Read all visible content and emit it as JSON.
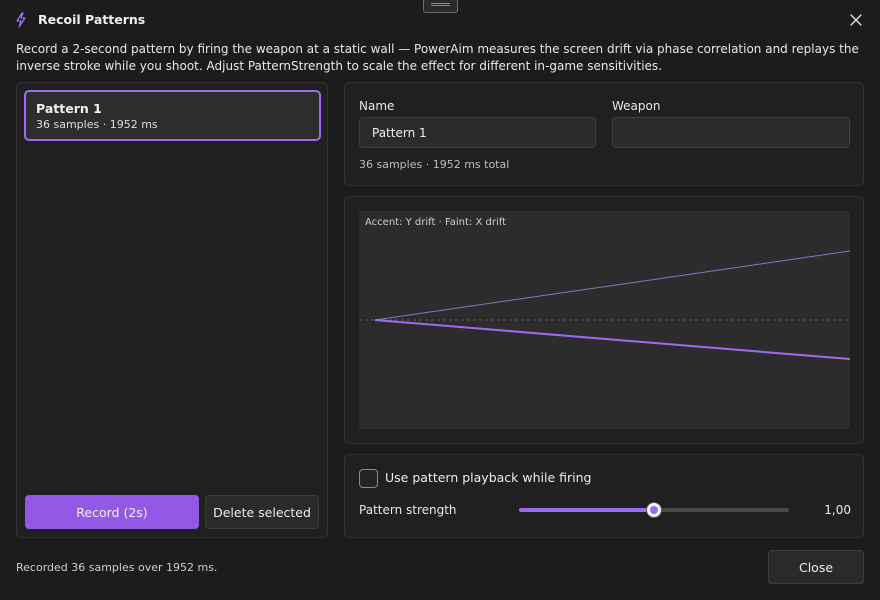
{
  "window": {
    "title": "Recoil Patterns",
    "accent": "#9b6cf2"
  },
  "description": "Record a 2-second pattern by firing the weapon at a static wall — PowerAim measures the screen drift via phase correlation and replays the inverse stroke while you shoot. Adjust PatternStrength to scale the effect for different in-game sensitivities.",
  "patterns": [
    {
      "name": "Pattern 1",
      "meta": "36 samples · 1952 ms",
      "selected": true
    }
  ],
  "buttons": {
    "record": "Record (2s)",
    "delete": "Delete selected",
    "close": "Close"
  },
  "fields": {
    "name_label": "Name",
    "name_value": "Pattern 1",
    "weapon_label": "Weapon",
    "weapon_value": "",
    "meta": "36 samples · 1952 ms total"
  },
  "chart_data": {
    "type": "line",
    "legend": "Accent: Y drift · Faint: X drift",
    "series": [
      {
        "key": "y_drift",
        "color": "#9b6cf2",
        "start": 0,
        "end": -0.43
      },
      {
        "key": "x_drift",
        "color": "#8878b8",
        "start": 0,
        "end": 0.76
      }
    ],
    "ylim": [
      -1.2,
      1.2
    ],
    "zero_line": true
  },
  "playback": {
    "checkbox_label": "Use pattern playback while firing",
    "checked": false,
    "strength_label": "Pattern strength",
    "strength_fraction": 0.5,
    "strength_value": "1,00"
  },
  "status": "Recorded 36 samples over 1952 ms."
}
